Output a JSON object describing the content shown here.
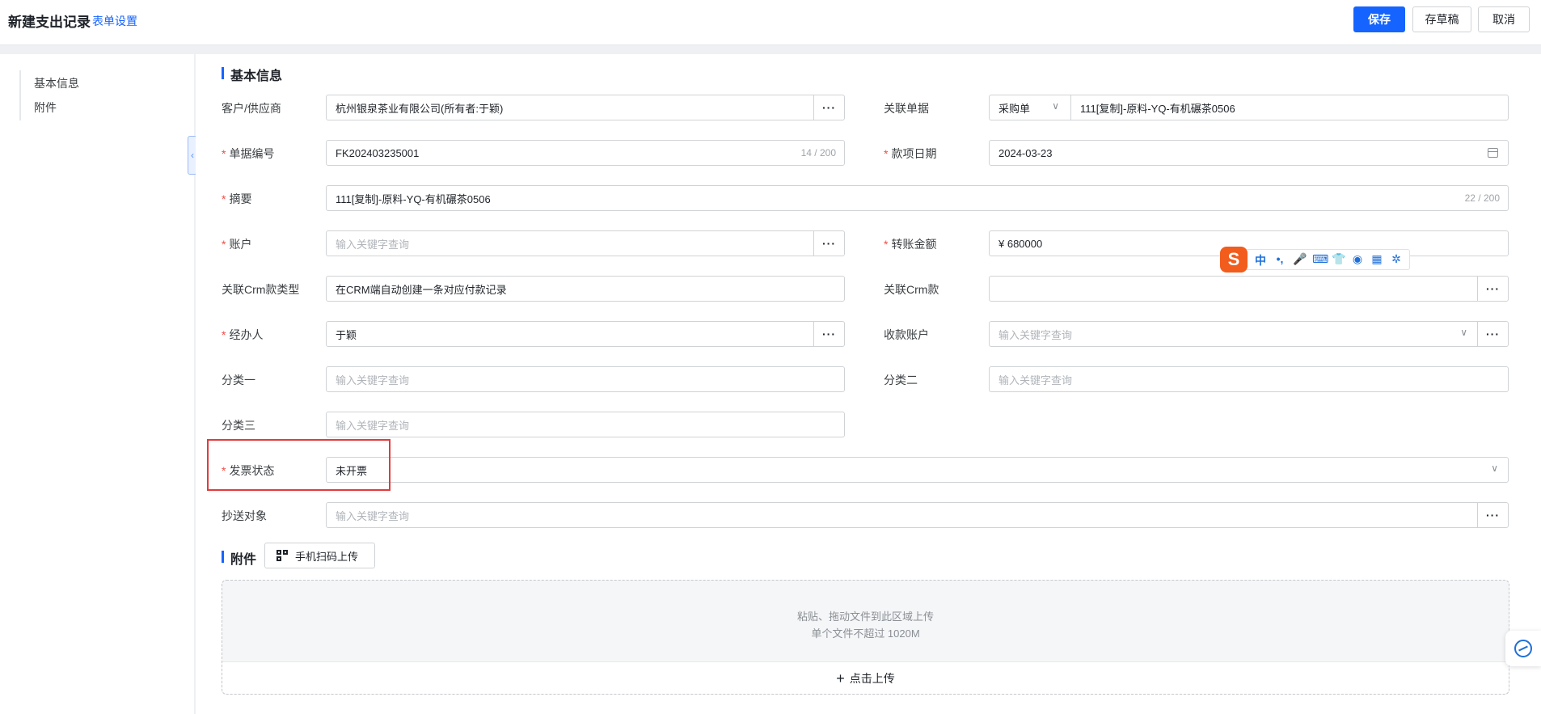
{
  "header": {
    "title": "新建支出记录",
    "form_settings": "表单设置",
    "save": "保存",
    "draft": "存草稿",
    "cancel": "取消"
  },
  "sidebar": {
    "items": [
      {
        "label": "基本信息"
      },
      {
        "label": "附件"
      }
    ],
    "collapse_icon": "chevron-left-icon"
  },
  "sections": {
    "basic_info": "基本信息",
    "attachments": "附件"
  },
  "fields": {
    "customer_supplier": {
      "label": "客户/供应商",
      "value": "杭州银泉茶业有限公司(所有者:于颖)"
    },
    "related_doc": {
      "label": "关联单据",
      "type_value": "采购单",
      "value": "111[复制]-原料-YQ-有机碾茶0506"
    },
    "doc_no": {
      "label": "单据编号",
      "value": "FK202403235001",
      "count": "14 / 200"
    },
    "payment_date": {
      "label": "款项日期",
      "value": "2024-03-23"
    },
    "summary": {
      "label": "摘要",
      "value": "111[复制]-原料-YQ-有机碾茶0506",
      "count": "22 / 200"
    },
    "account": {
      "label": "账户",
      "placeholder": "输入关键字查询"
    },
    "transfer_amount": {
      "label": "转账金额",
      "value": "¥ 680000"
    },
    "crm_type": {
      "label": "关联Crm款类型",
      "value": "在CRM端自动创建一条对应付款记录"
    },
    "crm_payment": {
      "label": "关联Crm款",
      "value": ""
    },
    "handler": {
      "label": "经办人",
      "value": "于颖"
    },
    "receiving_account": {
      "label": "收款账户",
      "placeholder": "输入关键字查询"
    },
    "category1": {
      "label": "分类一",
      "placeholder": "输入关键字查询"
    },
    "category2": {
      "label": "分类二",
      "placeholder": "输入关键字查询"
    },
    "category3": {
      "label": "分类三",
      "placeholder": "输入关键字查询"
    },
    "invoice_status": {
      "label": "发票状态",
      "value": "未开票"
    },
    "cc": {
      "label": "抄送对象",
      "placeholder": "输入关键字查询"
    }
  },
  "upload": {
    "scan_button": "手机扫码上传",
    "hint1": "粘贴、拖动文件到此区域上传",
    "hint2": "单个文件不超过 1020M",
    "click_upload": "点击上传"
  },
  "ime": {
    "logo": "S",
    "items": [
      "中",
      "•,",
      "🎤",
      "⌨",
      "👕",
      "◉",
      "▦",
      "✲"
    ]
  },
  "colors": {
    "primary": "#1664ff",
    "required": "#f54a45",
    "highlight": "#e23b3b"
  }
}
